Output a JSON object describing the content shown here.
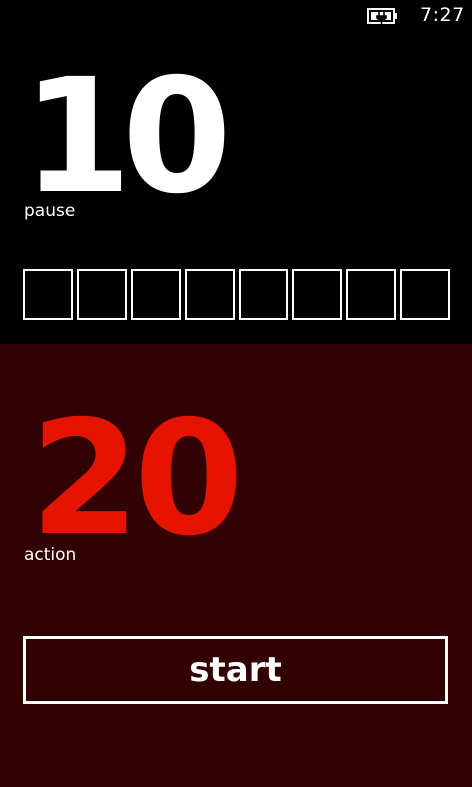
{
  "status_bar": {
    "time": "7:27",
    "battery_icon": "battery-charging-icon"
  },
  "pause": {
    "value": "10",
    "label": "pause",
    "progress_total": 8,
    "progress_filled": 0
  },
  "action": {
    "value": "20",
    "label": "action",
    "start_label": "start"
  },
  "colors": {
    "pause_bg": "#000000",
    "action_bg": "#320202",
    "accent": "#e51400",
    "foreground": "#ffffff"
  }
}
